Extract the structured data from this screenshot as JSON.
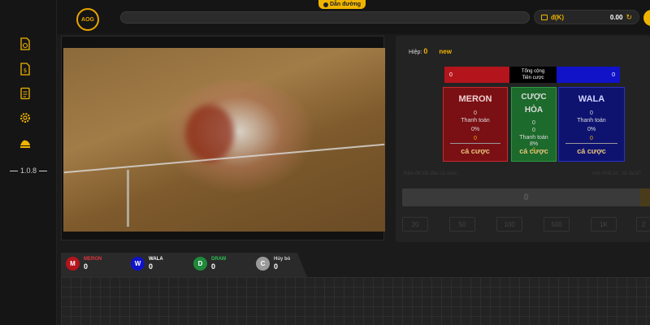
{
  "topbar": {
    "logo_text": "AOG",
    "guide_label": "Dẫn đường",
    "wallet": {
      "currency": "đ(K)",
      "balance": "0.00"
    }
  },
  "sidebar": {
    "version": "1.0.8"
  },
  "round": {
    "label": "Hiệp:",
    "number": "0",
    "status": "new"
  },
  "totals": {
    "meron": "0",
    "wala": "0",
    "center_line1": "Tổng cộng",
    "center_line2": "Tiền cược"
  },
  "bets": {
    "meron": {
      "name": "MERON",
      "amount": "0",
      "payout_label": "Thanh toán",
      "percent": "0%",
      "payout": "0",
      "cta": "cá cược"
    },
    "draw": {
      "name": "CƯỢC HÒA",
      "amount": "0",
      "value2": "0",
      "payout_label": "Thanh toán",
      "percent": "8%",
      "payout": "0",
      "cta": "cá cược"
    },
    "wala": {
      "name": "WALA",
      "amount": "0",
      "payout_label": "Thanh toán",
      "percent": "0%",
      "payout": "0",
      "cta": "cá cược"
    }
  },
  "bet_form": {
    "hint": "Bấm để bắt đầu cá cược",
    "limit": "nhỏ nhất:20 , tối đa:50",
    "amount": "0",
    "chips": [
      "20",
      "50",
      "100",
      "500",
      "1K",
      "2"
    ]
  },
  "results": [
    {
      "letter": "M",
      "name": "MERON",
      "count": "0",
      "color": "#b4141c",
      "name_color": "#e0363c"
    },
    {
      "letter": "W",
      "name": "WALA",
      "count": "0",
      "color": "#1013c8",
      "name_color": "#ffffff"
    },
    {
      "letter": "D",
      "name": "DRAW",
      "count": "0",
      "color": "#1f8a3b",
      "name_color": "#2fbf55"
    },
    {
      "letter": "C",
      "name": "Hủy bỏ",
      "count": "0",
      "color": "#9a9a9a",
      "name_color": "#cfcfcf"
    }
  ],
  "colors": {
    "accent": "#f0b400",
    "meron": "#b4141c",
    "wala": "#1013c8",
    "draw": "#1f8a3b"
  }
}
